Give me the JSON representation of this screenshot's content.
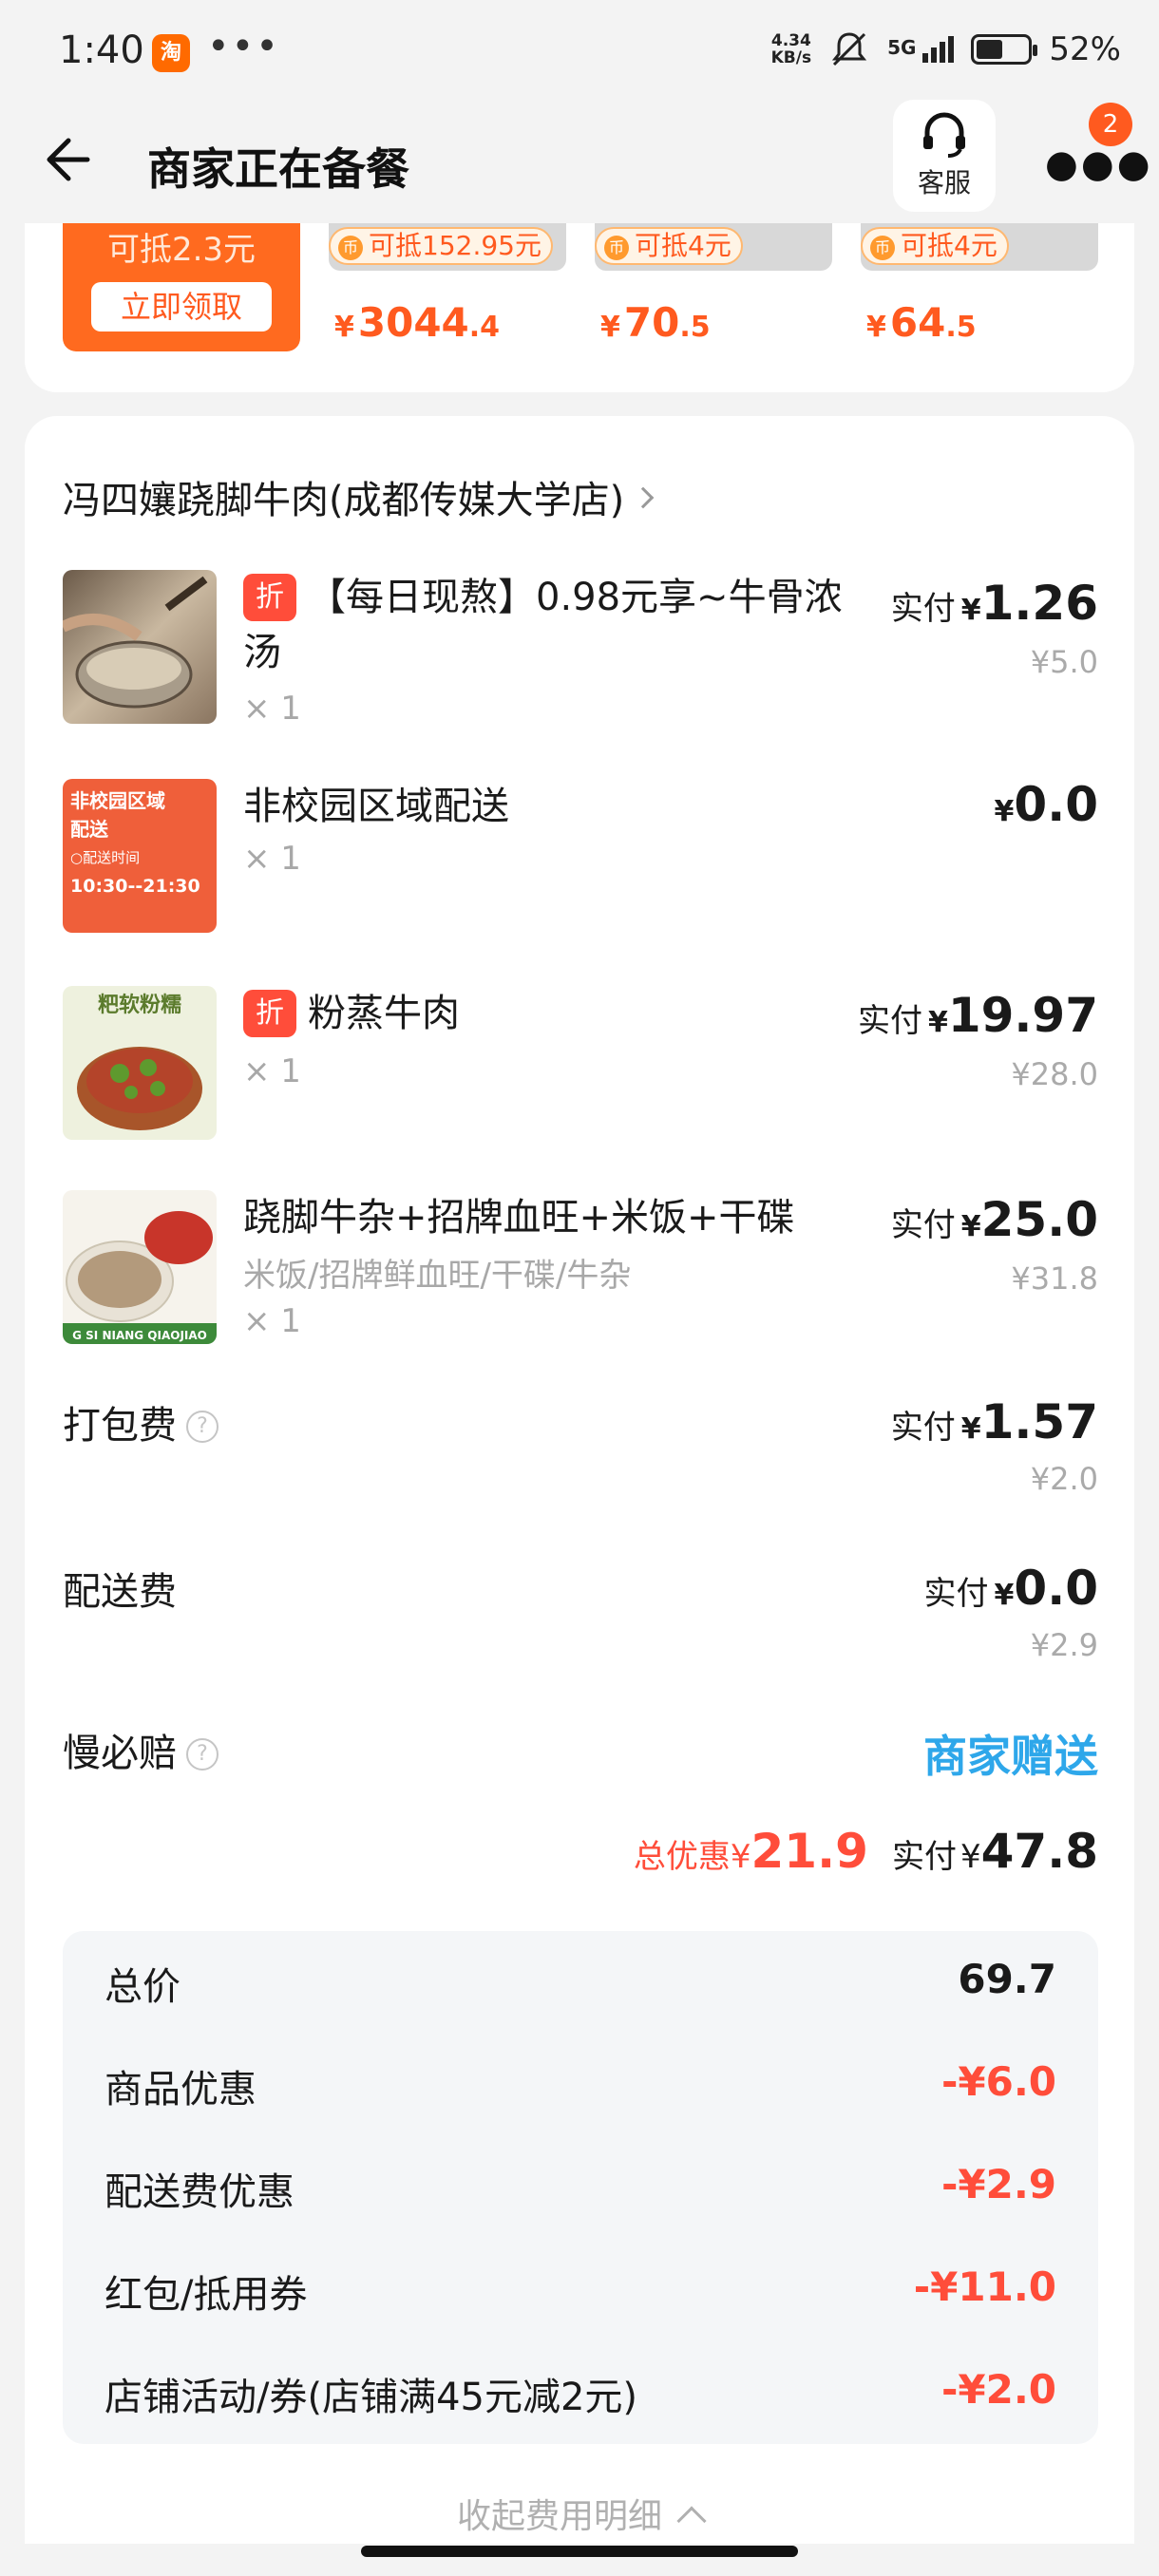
{
  "status_bar": {
    "time": "1:40",
    "app_icon_text": "淘",
    "more_dots": "•••",
    "net_speed_value": "4.34",
    "net_speed_unit": "KB/s",
    "signal": "5G",
    "battery_percent": "52%",
    "battery_level": 0.52
  },
  "header": {
    "title": "商家正在备餐",
    "service_label": "客服",
    "notification_count": "2"
  },
  "promo": {
    "coupon_amount": "可抵2.3元",
    "claim_button": "立即领取",
    "coin_symbol": "币",
    "products": [
      {
        "tag": "可抵152.95元",
        "price_int": "3044",
        "price_dec": ".4",
        "yen": "¥"
      },
      {
        "tag": "可抵4元",
        "price_int": "70",
        "price_dec": ".5",
        "yen": "¥"
      },
      {
        "tag": "可抵4元",
        "price_int": "64",
        "price_dec": ".5",
        "yen": "¥"
      }
    ]
  },
  "order": {
    "shop_name": "冯四孃跷脚牛肉(成都传媒大学店)",
    "discount_tag": "折",
    "pay_label": "实付",
    "yen": "¥",
    "items": [
      {
        "name": "【每日现熬】0.98元享~牛骨浓汤",
        "subtitle": "",
        "qty": "× 1",
        "paid": "1.26",
        "original": "¥5.0"
      },
      {
        "name": "非校园区域配送",
        "subtitle": "",
        "qty": "× 1",
        "paid": "0.0",
        "original": ""
      },
      {
        "name": "粉蒸牛肉",
        "subtitle": "",
        "qty": "× 1",
        "paid": "19.97",
        "original": "¥28.0"
      },
      {
        "name": "跷脚牛杂+招牌血旺+米饭+干碟",
        "subtitle": "米饭/招牌鲜血旺/干碟/牛杂",
        "qty": "× 1",
        "paid": "25.0",
        "original": "¥31.8"
      }
    ],
    "thumb2_text": {
      "line1": "非校园区域",
      "line2": "配送",
      "line3": "○配送时间",
      "line4": "10:30--21:30"
    },
    "thumb3_text": "粑软粉糯",
    "thumb4_text": "G SI NIANG QIAOJIAO",
    "packing_fee": {
      "label": "打包费",
      "paid": "1.57",
      "original": "¥2.0"
    },
    "delivery_fee": {
      "label": "配送费",
      "paid": "0.0",
      "original": "¥2.9"
    },
    "late_comp": {
      "label": "慢必赔",
      "value": "商家赠送"
    },
    "help_icon": "?",
    "summary": {
      "discount_label": "总优惠",
      "discount": "21.9",
      "paid": "47.8"
    }
  },
  "breakdown": {
    "rows": [
      {
        "label": "总价",
        "value": "69.7"
      },
      {
        "label": "商品优惠",
        "value": "-¥6.0"
      },
      {
        "label": "配送费优惠",
        "value": "-¥2.9"
      },
      {
        "label": "红包/抵用券",
        "value": "-¥11.0"
      },
      {
        "label": "店铺活动/券(店铺满45元减2元)",
        "value": "-¥2.0"
      }
    ],
    "collapse_label": "收起费用明细"
  },
  "colors": {
    "accent": "#ff5a1f",
    "discount_red": "#ff4d3a",
    "gift_blue": "#2ea7ea"
  }
}
